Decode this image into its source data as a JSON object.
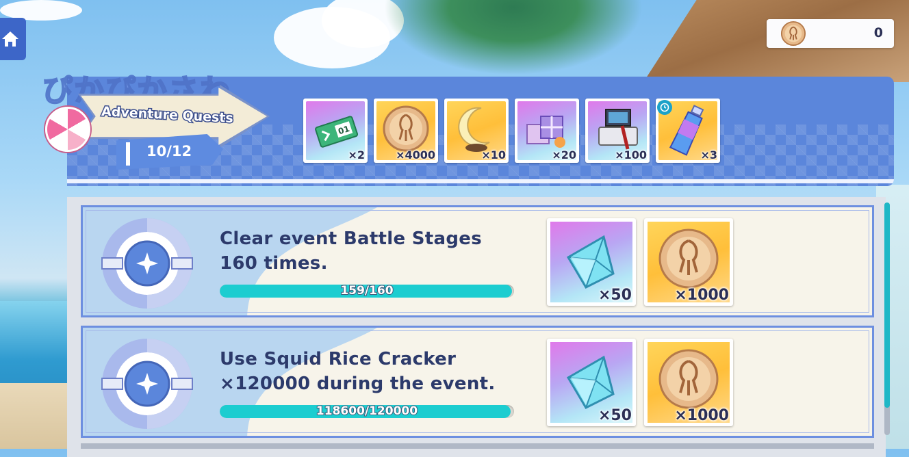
{
  "header": {
    "jp_title": "ぴかぴかさわ",
    "banner_label": "Adventure Quests",
    "progress": "10/12"
  },
  "currency": {
    "icon": "squid-cracker-icon",
    "value": "0"
  },
  "completion_rewards": [
    {
      "icon": "ticket-icon",
      "qty": "×2",
      "bg": "purple"
    },
    {
      "icon": "squid-cracker-icon",
      "qty": "×4000",
      "bg": "gold"
    },
    {
      "icon": "moon-lamp-icon",
      "qty": "×10",
      "bg": "gold"
    },
    {
      "icon": "gift-boxes-icon",
      "qty": "×20",
      "bg": "purple"
    },
    {
      "icon": "jewelry-box-icon",
      "qty": "×100",
      "bg": "purple"
    },
    {
      "icon": "stamina-drink-icon",
      "qty": "×3",
      "bg": "gold",
      "timed": true
    }
  ],
  "quests": [
    {
      "text": "Clear event Battle Stages 160 times.",
      "progress_label": "159/160",
      "progress_fraction": 0.994,
      "rewards": [
        {
          "icon": "crystal-icon",
          "qty": "×50",
          "bg": "purple"
        },
        {
          "icon": "squid-cracker-icon",
          "qty": "×1000",
          "bg": "gold"
        }
      ]
    },
    {
      "text": "Use Squid Rice Cracker ×120000 during the event.",
      "progress_label": "118600/120000",
      "progress_fraction": 0.988,
      "rewards": [
        {
          "icon": "crystal-icon",
          "qty": "×50",
          "bg": "purple"
        },
        {
          "icon": "squid-cracker-icon",
          "qty": "×1000",
          "bg": "gold"
        }
      ]
    }
  ],
  "colors": {
    "accent": "#5b86db",
    "progress_fill": "#1ccdd0",
    "text_dark": "#2c3a6b"
  }
}
